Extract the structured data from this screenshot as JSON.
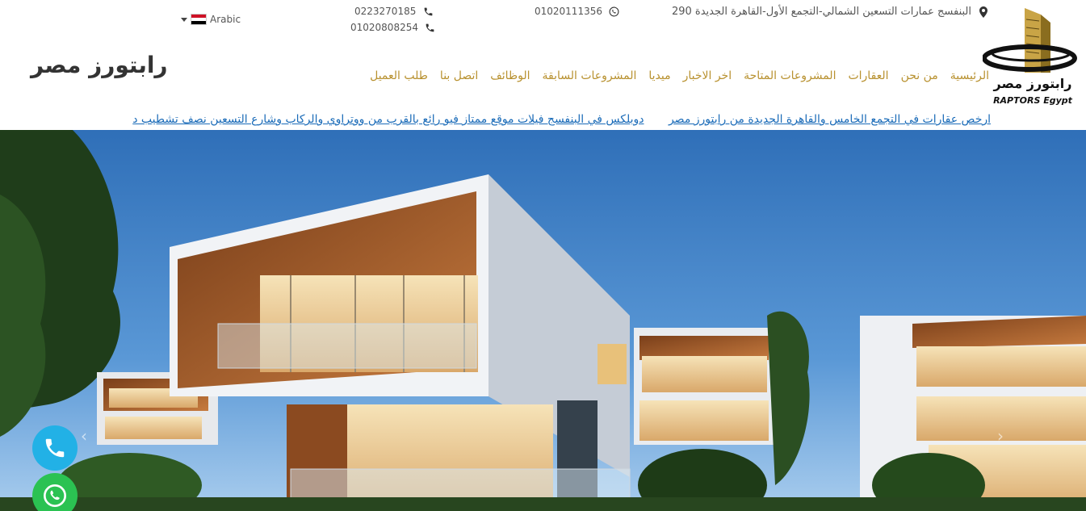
{
  "topbar": {
    "language": "Arabic",
    "phone1": "0223270185",
    "phone2": "01020808254",
    "whatsapp": "01020111356",
    "address": "290 البنفسج عمارات التسعين الشمالي-التجمع الأول-القاهرة الجديدة"
  },
  "logo": {
    "ar": "رابتورز مصر",
    "en": "RAPTORS Egypt"
  },
  "brand": "رابتورز مصر",
  "nav": [
    "الرئيسية",
    "من نحن",
    "العقارات",
    "المشروعات المتاحة",
    "اخر الاخبار",
    "ميديا",
    "المشروعات السابقة",
    "الوظائف",
    "اتصل بنا",
    "طلب العميل"
  ],
  "ticker": [
    "ارخص عقارات في التجمع الخامس والقاهرة الجديدة من رابتورز مصر",
    "دوبلكس في البنفسج فيلات موقع ممتاز فيو رائع بالقرب من ووتراوي والركاب وشارع التسعين نصف تشطيب د"
  ],
  "colors": {
    "nav": "#b8912f",
    "ticker_link": "#1a6bb8",
    "call_button": "#22b1e6",
    "whatsapp_button": "#2bc252"
  },
  "icons": {
    "address": "map-marker-icon",
    "whatsapp": "whatsapp-icon",
    "phone": "phone-icon"
  }
}
